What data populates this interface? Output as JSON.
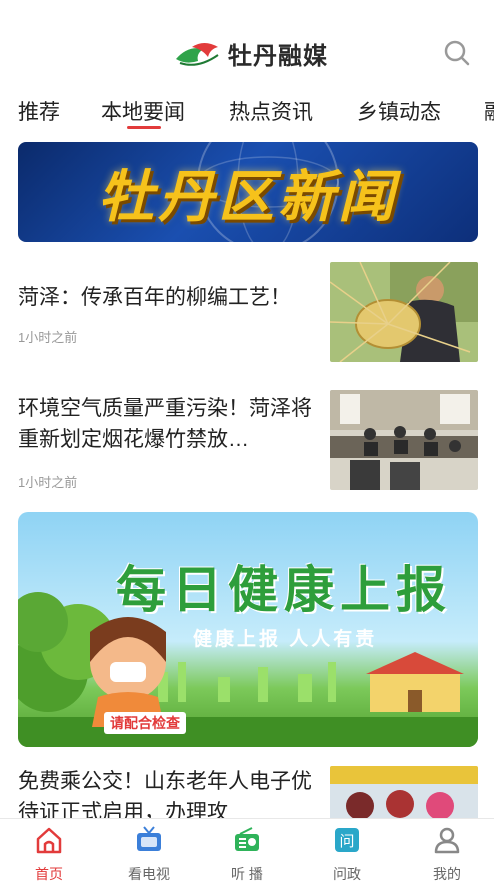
{
  "header": {
    "logo_text": "牡丹融媒"
  },
  "tabs": [
    {
      "label": "推荐"
    },
    {
      "label": "本地要闻"
    },
    {
      "label": "热点资讯"
    },
    {
      "label": "乡镇动态"
    },
    {
      "label": "融"
    }
  ],
  "banner": {
    "title": "牡丹区新闻"
  },
  "news": [
    {
      "title": "菏泽：传承百年的柳编工艺！",
      "time": "1小时之前"
    },
    {
      "title": "环境空气质量严重污染！菏泽将重新划定烟花爆竹禁放…",
      "time": "1小时之前"
    },
    {
      "title": "免费乘公交！山东老年人电子优待证正式启用，办理攻"
    }
  ],
  "health_banner": {
    "title": "每日健康上报",
    "subtitle": "健康上报 人人有责",
    "badge": "请配合检查"
  },
  "bottom_nav": [
    {
      "label": "首页",
      "icon": "home-icon"
    },
    {
      "label": "看电视",
      "icon": "tv-icon"
    },
    {
      "label": "听 播",
      "icon": "radio-icon"
    },
    {
      "label": "问政",
      "icon": "ask-icon"
    },
    {
      "label": "我的",
      "icon": "user-icon"
    }
  ],
  "colors": {
    "accent": "#e23b3b",
    "nav_blue": "#3b7fd9",
    "nav_green": "#2fb35a",
    "nav_teal": "#2aa7c9"
  }
}
